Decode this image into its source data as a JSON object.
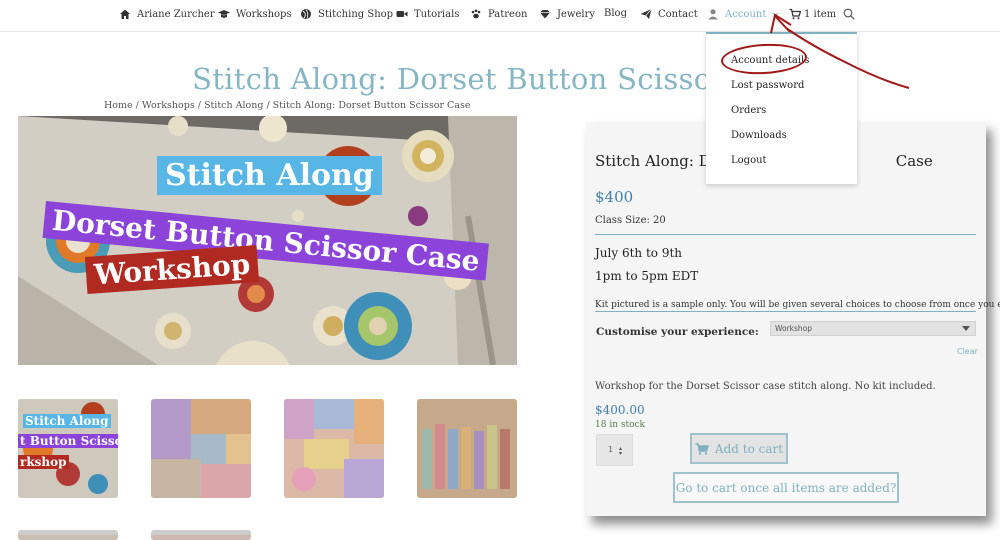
{
  "nav": {
    "site_name": "Ariane Zurcher",
    "workshops": "Workshops",
    "stitching_shop": "Stitching Shop",
    "tutorials": "Tutorials",
    "patreon": "Patreon",
    "jewelry": "Jewelry",
    "blog": "Blog",
    "contact": "Contact",
    "account": "Account",
    "cart": "1 item",
    "accent_color": "#7fb1c0"
  },
  "account_menu": {
    "items": [
      "Account details",
      "Lost password",
      "Orders",
      "Downloads",
      "Logout"
    ],
    "annotation_color": "#a01818"
  },
  "page": {
    "title": "Stitch Along: Dorset Button Scissor Case",
    "breadcrumb": {
      "home": "Home",
      "workshops": "Workshops",
      "stitch_along": "Stitch Along",
      "current": "Stitch Along: Dorset Button Scissor Case",
      "sep": " / "
    }
  },
  "hero": {
    "banner1": "Stitch Along",
    "banner2": "Dorset Button Scissor Case",
    "banner3": "Workshop"
  },
  "thumbs": {
    "t1_line1": "Stitch Along",
    "t1_line2": "t Button Scisso",
    "t1_line3": "rkshop"
  },
  "product": {
    "title_left": "Stitch Along: Do",
    "title_right": "Case",
    "price": "$400",
    "class_size": "Class Size: 20",
    "date": "July 6th to 9th",
    "time": "1pm to 5pm EDT",
    "kit_note": "Kit pictured is a sample only.  You will be given several choices to choose from once you enroll.",
    "customise_label": "Customise your experience:",
    "option_selected": "Workshop",
    "clear": "Clear",
    "variation_desc": "Workshop for the Dorset Scissor case stitch along. No kit included.",
    "variation_price": "$400.00",
    "stock": "18 in stock",
    "quantity": "1",
    "add_to_cart": "Add to cart",
    "go_to_cart": "Go to cart once all items are added?",
    "price_color": "#3f7fab"
  }
}
